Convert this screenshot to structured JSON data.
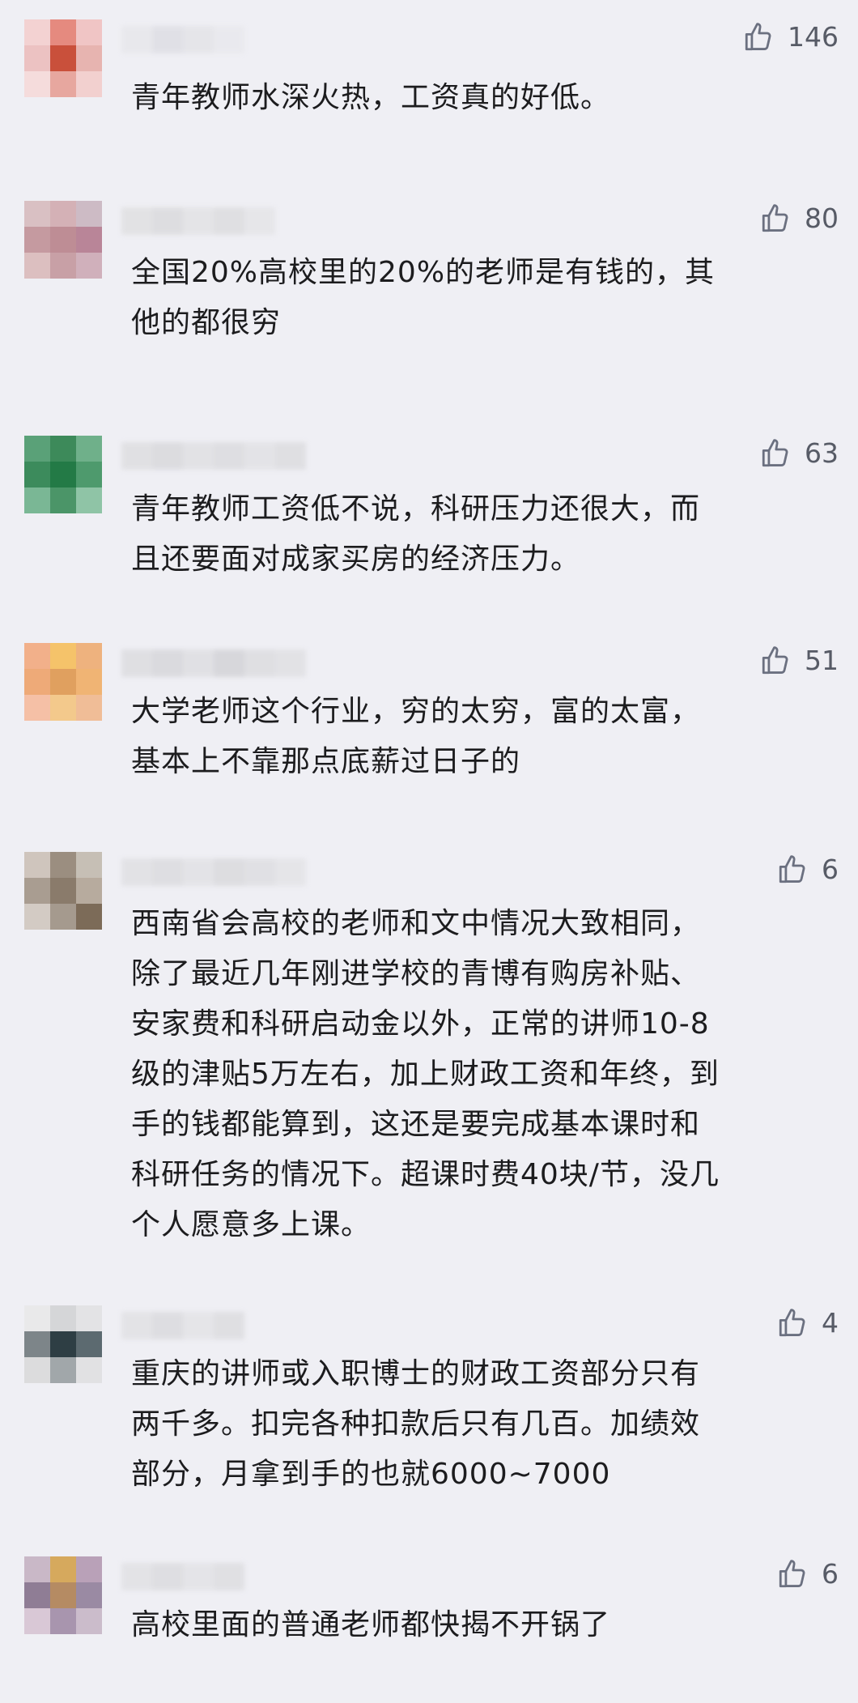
{
  "comments": [
    {
      "likes": "146",
      "text": "青年教师水深火热，工资真的好低。",
      "avatar": [
        "#f3d2d2",
        "#e58a7f",
        "#f0c5c5",
        "#ecc2c2",
        "#c9503b",
        "#e7b4b0",
        "#f5dcdc",
        "#e7a79f",
        "#f2d0cf"
      ],
      "name_blur": [
        "#e6e6ea",
        "#dcdce2",
        "#e2e2e6",
        "#e8e8ec"
      ]
    },
    {
      "likes": "80",
      "text": "全国20%高校里的20%的老师是有钱的，其\n他的都很穷",
      "avatar": [
        "#d9c0c3",
        "#d4b1b6",
        "#cdbbc5",
        "#c59aa0",
        "#be8d95",
        "#b98598",
        "#dcbfc0",
        "#c8a0a6",
        "#d0b0bb"
      ],
      "name_blur": [
        "#dededf",
        "#d8d8da",
        "#e1e1e3",
        "#dadadc",
        "#e3e3e6"
      ]
    },
    {
      "likes": "63",
      "text": "青年教师工资低不说，科研压力还很大，而\n且还要面对成家买房的经济压力。",
      "avatar": [
        "#5aa178",
        "#3d8a5a",
        "#6fb08a",
        "#3c8b5c",
        "#237a46",
        "#4e9a6d",
        "#7ab795",
        "#4b9568",
        "#8fc4a6"
      ],
      "name_blur": [
        "#dcdcde",
        "#d6d6d9",
        "#dedee1",
        "#d9d9dc",
        "#e0e0e3",
        "#dadadd"
      ]
    },
    {
      "likes": "51",
      "text": "大学老师这个行业，穷的太穷，富的太富，\n基本上不靠那点底薪过日子的",
      "avatar": [
        "#f2b08a",
        "#f5c36a",
        "#eeb27e",
        "#eeaa78",
        "#e0a05f",
        "#f0b474",
        "#f5c0a6",
        "#f3c98c",
        "#f0bd97"
      ],
      "name_blur": [
        "#dadadd",
        "#d3d3d7",
        "#dcdcdf",
        "#cfcfd3",
        "#dadadd",
        "#dedee1"
      ]
    },
    {
      "likes": "6",
      "text": "西南省会高校的老师和文中情况大致相同，\n除了最近几年刚进学校的青博有购房补贴、\n安家费和科研启动金以外，正常的讲师10-8\n级的津贴5万左右，加上财政工资和年终，到\n手的钱都能算到，这还是要完成基本课时和\n科研任务的情况下。超课时费40块/节，没几\n个人愿意多上课。",
      "avatar": [
        "#cfc5bd",
        "#9b8e80",
        "#c6bfb5",
        "#a99d91",
        "#8a7b6b",
        "#b7ab9e",
        "#d3cbc4",
        "#a59a8e",
        "#7c6b58"
      ],
      "name_blur": [
        "#dedee1",
        "#d9d9dc",
        "#e0e0e3",
        "#d7d7da",
        "#dcdcdf",
        "#e2e2e5"
      ]
    },
    {
      "likes": "4",
      "text": "重庆的讲师或入职博士的财政工资部分只有\n两千多。扣完各种扣款后只有几百。加绩效\n部分，月拿到手的也就6000~7000",
      "avatar": [
        "#e9e9ea",
        "#d5d6d8",
        "#e3e3e5",
        "#7d8589",
        "#2e3e44",
        "#5c6a70",
        "#dcdcdd",
        "#a1a7aa",
        "#e1e1e3"
      ],
      "name_blur": [
        "#dfdfe2",
        "#d8d8db",
        "#e2e2e5",
        "#dadadd"
      ]
    },
    {
      "likes": "6",
      "text": "高校里面的普通老师都快揭不开锅了",
      "avatar": [
        "#c9b8c7",
        "#d6a95d",
        "#b9a1b8",
        "#8f7d95",
        "#b58b63",
        "#9a8aa3",
        "#d9c8d6",
        "#a895ae",
        "#cbbccb"
      ],
      "name_blur": [
        "#dfdfe2",
        "#d9d9dc",
        "#e1e1e4",
        "#dbdbde"
      ]
    }
  ]
}
